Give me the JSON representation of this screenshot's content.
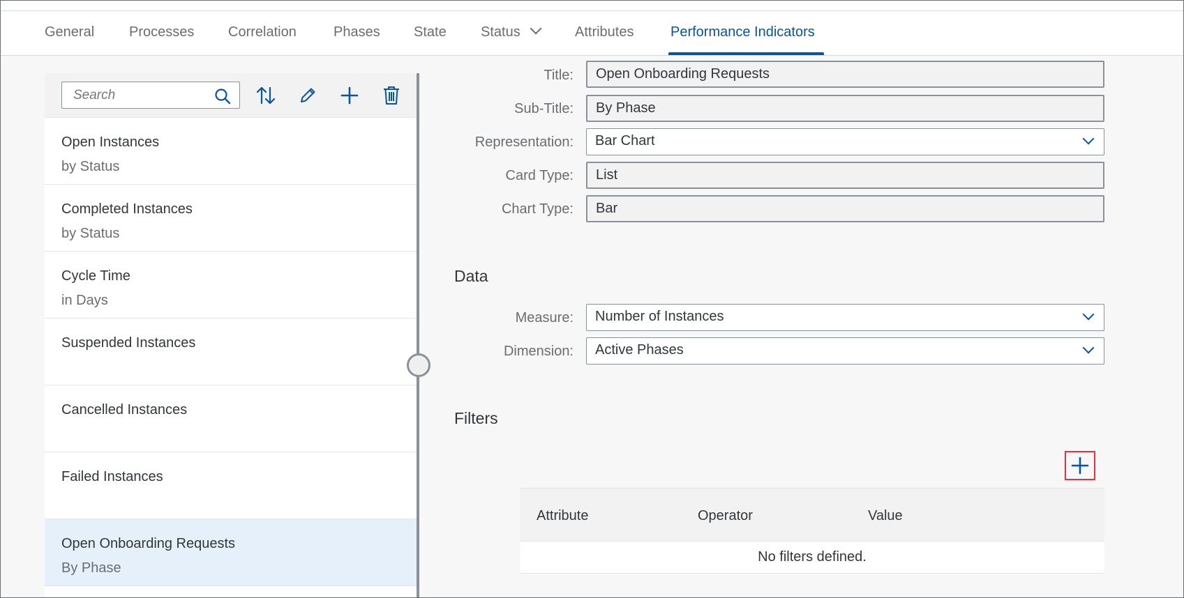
{
  "tabs": [
    {
      "label": "General",
      "active": false
    },
    {
      "label": "Processes",
      "active": false
    },
    {
      "label": "Correlation",
      "active": false
    },
    {
      "label": "Phases",
      "active": false
    },
    {
      "label": "State",
      "active": false
    },
    {
      "label": "Status",
      "active": false,
      "has_dropdown": true
    },
    {
      "label": "Attributes",
      "active": false
    },
    {
      "label": "Performance Indicators",
      "active": true
    }
  ],
  "master": {
    "search_placeholder": "Search",
    "toolbar_icons": [
      "sort-icon",
      "edit-icon",
      "add-icon",
      "delete-icon"
    ],
    "items": [
      {
        "title": "Open Instances",
        "subtitle": "by Status",
        "selected": false
      },
      {
        "title": "Completed Instances",
        "subtitle": "by Status",
        "selected": false
      },
      {
        "title": "Cycle Time",
        "subtitle": "in Days",
        "selected": false
      },
      {
        "title": "Suspended Instances",
        "subtitle": "",
        "selected": false
      },
      {
        "title": "Cancelled Instances",
        "subtitle": "",
        "selected": false
      },
      {
        "title": "Failed Instances",
        "subtitle": "",
        "selected": false
      },
      {
        "title": "Open Onboarding Requests",
        "subtitle": "By Phase",
        "selected": true
      }
    ]
  },
  "form": {
    "title": {
      "label": "Title:",
      "value": "Open Onboarding Requests"
    },
    "subtitle": {
      "label": "Sub-Title:",
      "value": "By Phase"
    },
    "representation": {
      "label": "Representation:",
      "value": "Bar Chart"
    },
    "card_type": {
      "label": "Card Type:",
      "value": "List"
    },
    "chart_type": {
      "label": "Chart Type:",
      "value": "Bar"
    }
  },
  "data_section": {
    "title": "Data",
    "measure": {
      "label": "Measure:",
      "value": "Number of Instances"
    },
    "dimension": {
      "label": "Dimension:",
      "value": "Active Phases"
    }
  },
  "filters": {
    "title": "Filters",
    "columns": [
      "Attribute",
      "Operator",
      "Value"
    ],
    "empty_text": "No filters defined."
  },
  "colors": {
    "accent": "#0854a0",
    "highlight_box": "#e3313d",
    "selected_row": "#e5f0fa"
  }
}
